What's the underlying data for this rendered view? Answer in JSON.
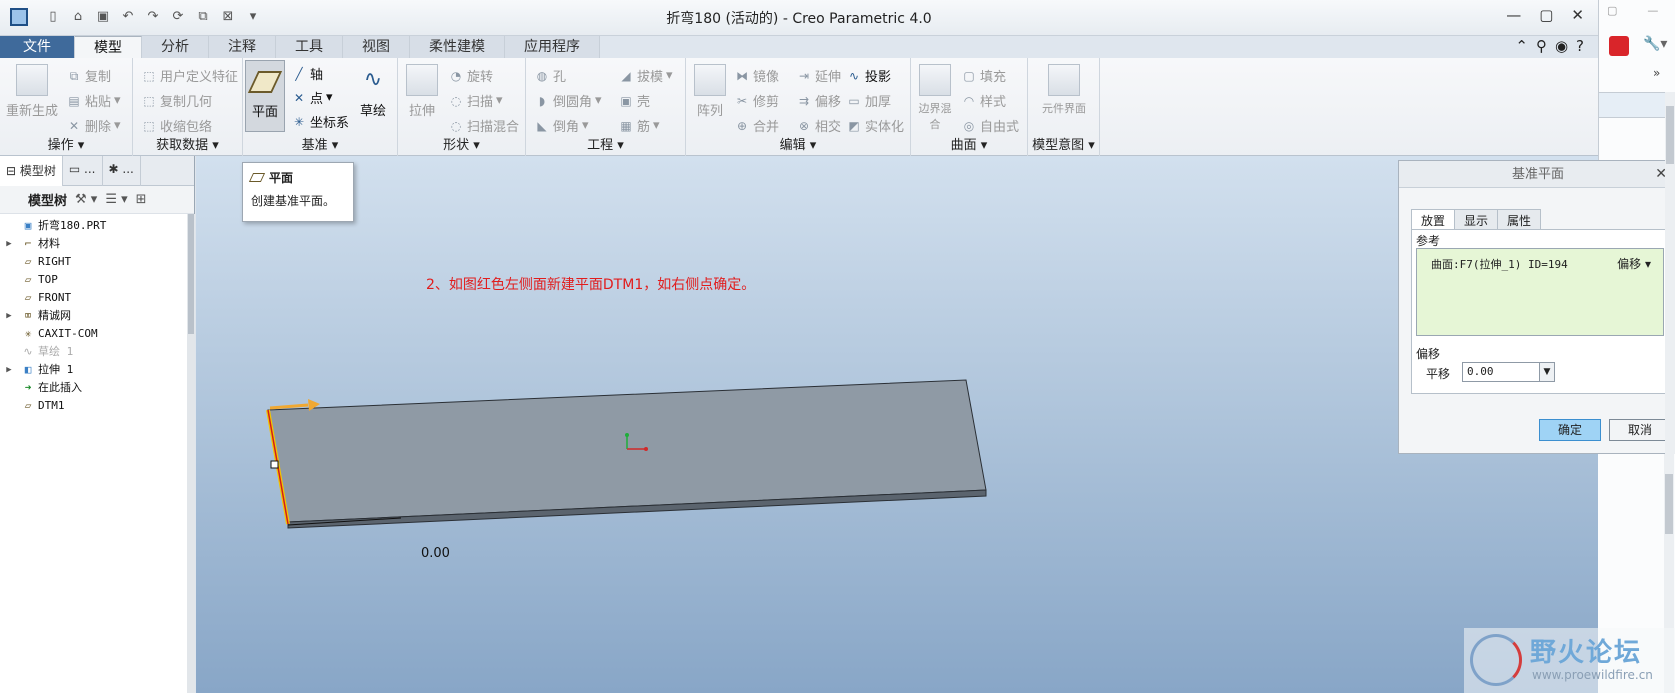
{
  "window": {
    "title": "折弯180 (活动的) - Creo Parametric 4.0"
  },
  "ribbon_tabs": [
    {
      "label": "文件"
    },
    {
      "label": "模型"
    },
    {
      "label": "分析"
    },
    {
      "label": "注释"
    },
    {
      "label": "工具"
    },
    {
      "label": "视图"
    },
    {
      "label": "柔性建模"
    },
    {
      "label": "应用程序"
    }
  ],
  "ribbon": {
    "operations": {
      "label": "操作",
      "regenerate": "重新生成",
      "copy": "复制",
      "paste": "粘贴",
      "delete": "删除"
    },
    "get_data": {
      "label": "获取数据",
      "udf": "用户定义特征",
      "copy_geom": "复制几何",
      "shrinkwrap": "收缩包络"
    },
    "datum": {
      "label": "基准",
      "plane": "平面",
      "axis": "轴",
      "point": "点",
      "csys": "坐标系",
      "sketch": "草绘"
    },
    "shapes": {
      "label": "形状",
      "extrude": "拉伸",
      "revolve": "旋转",
      "sweep": "扫描",
      "swept_blend": "扫描混合"
    },
    "engineering": {
      "label": "工程",
      "hole": "孔",
      "round": "倒圆角",
      "chamfer": "倒角",
      "draft": "拔模",
      "shell": "壳",
      "rib": "筋"
    },
    "editing": {
      "label": "编辑",
      "pattern": "阵列",
      "mirror": "镜像",
      "trim": "修剪",
      "merge": "合并",
      "extend": "延伸",
      "offset": "偏移",
      "intersect": "相交",
      "project": "投影",
      "thicken": "加厚",
      "solidify": "实体化"
    },
    "surfaces": {
      "label": "曲面",
      "boundary_blend": "边界混合",
      "fill": "填充",
      "style": "样式",
      "freestyle": "自由式"
    },
    "design_intent": {
      "label": "模型意图",
      "component_interface": "元件界面"
    }
  },
  "left_panel": {
    "tabs": [
      {
        "label": "模型树"
      },
      {
        "label": "..."
      },
      {
        "label": "..."
      }
    ],
    "tree_header": "模型树",
    "tree": [
      {
        "label": "折弯180.PRT",
        "expand": "",
        "dim": false
      },
      {
        "label": "材料",
        "expand": "▶",
        "dim": false
      },
      {
        "label": "RIGHT",
        "expand": "",
        "dim": false
      },
      {
        "label": "TOP",
        "expand": "",
        "dim": false
      },
      {
        "label": "FRONT",
        "expand": "",
        "dim": false
      },
      {
        "label": "精诚网",
        "expand": "▶",
        "dim": false
      },
      {
        "label": "CAXIT-COM",
        "expand": "",
        "dim": false
      },
      {
        "label": "草绘 1",
        "expand": "",
        "dim": true
      },
      {
        "label": "拉伸 1",
        "expand": "▶",
        "dim": false
      },
      {
        "label": "在此插入",
        "expand": "",
        "dim": false
      },
      {
        "label": "DTM1",
        "expand": "",
        "dim": false
      }
    ]
  },
  "tooltip": {
    "title": "平面",
    "desc": "创建基准平面。"
  },
  "viewport": {
    "annotation": "2、如图红色左侧面新建平面DTM1，如右侧点确定。",
    "dimension": "0.00"
  },
  "dialog": {
    "title": "基准平面",
    "tabs": [
      {
        "label": "放置"
      },
      {
        "label": "显示"
      },
      {
        "label": "属性"
      }
    ],
    "references_label": "参考",
    "reference_item": "曲面:F7(拉伸_1) ID=194",
    "reference_type": "偏移",
    "offset_label": "偏移",
    "translation_label": "平移",
    "translation_value": "0.00",
    "ok": "确定",
    "cancel": "取消"
  },
  "watermark": {
    "name": "野火论坛",
    "url": "www.proewildfire.cn"
  }
}
